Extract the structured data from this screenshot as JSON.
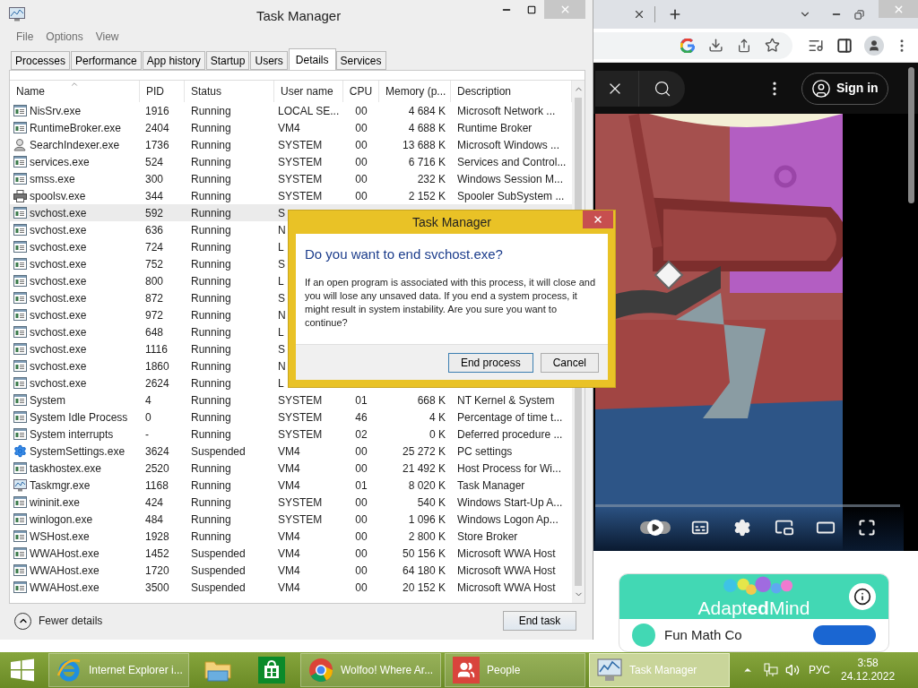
{
  "task_manager": {
    "title": "Task Manager",
    "menu": [
      "File",
      "Options",
      "View"
    ],
    "tabs": [
      {
        "label": "Processes",
        "selected": false
      },
      {
        "label": "Performance",
        "selected": false
      },
      {
        "label": "App history",
        "selected": false
      },
      {
        "label": "Startup",
        "selected": false
      },
      {
        "label": "Users",
        "selected": false
      },
      {
        "label": "Details",
        "selected": true
      },
      {
        "label": "Services",
        "selected": false
      }
    ],
    "columns": [
      {
        "label": "Name",
        "sorted": true
      },
      {
        "label": "PID",
        "sorted": false
      },
      {
        "label": "Status",
        "sorted": false
      },
      {
        "label": "User name",
        "sorted": false
      },
      {
        "label": "CPU",
        "sorted": false
      },
      {
        "label": "Memory (p...",
        "sorted": false
      },
      {
        "label": "Description",
        "sorted": false
      }
    ],
    "rows": [
      {
        "kind": "app",
        "name": "NisSrv.exe",
        "pid": "1916",
        "status": "Running",
        "user": "LOCAL SE...",
        "cpu": "00",
        "memory": "4 684 K",
        "description": "Microsoft Network ...",
        "selected": false
      },
      {
        "kind": "app",
        "name": "RuntimeBroker.exe",
        "pid": "2404",
        "status": "Running",
        "user": "VM4",
        "cpu": "00",
        "memory": "4 688 K",
        "description": "Runtime Broker",
        "selected": false
      },
      {
        "kind": "search",
        "name": "SearchIndexer.exe",
        "pid": "1736",
        "status": "Running",
        "user": "SYSTEM",
        "cpu": "00",
        "memory": "13 688 K",
        "description": "Microsoft Windows ...",
        "selected": false
      },
      {
        "kind": "app",
        "name": "services.exe",
        "pid": "524",
        "status": "Running",
        "user": "SYSTEM",
        "cpu": "00",
        "memory": "6 716 K",
        "description": "Services and Control...",
        "selected": false
      },
      {
        "kind": "app",
        "name": "smss.exe",
        "pid": "300",
        "status": "Running",
        "user": "SYSTEM",
        "cpu": "00",
        "memory": "232 K",
        "description": "Windows Session M...",
        "selected": false
      },
      {
        "kind": "printer",
        "name": "spoolsv.exe",
        "pid": "344",
        "status": "Running",
        "user": "SYSTEM",
        "cpu": "00",
        "memory": "2 152 K",
        "description": "Spooler SubSystem ...",
        "selected": false
      },
      {
        "kind": "app",
        "name": "svchost.exe",
        "pid": "592",
        "status": "Running",
        "user": "S",
        "selected": true
      },
      {
        "kind": "app",
        "name": "svchost.exe",
        "pid": "636",
        "status": "Running",
        "user": "N",
        "selected": false
      },
      {
        "kind": "app",
        "name": "svchost.exe",
        "pid": "724",
        "status": "Running",
        "user": "L",
        "selected": false
      },
      {
        "kind": "app",
        "name": "svchost.exe",
        "pid": "752",
        "status": "Running",
        "user": "S",
        "selected": false
      },
      {
        "kind": "app",
        "name": "svchost.exe",
        "pid": "800",
        "status": "Running",
        "user": "L",
        "selected": false
      },
      {
        "kind": "app",
        "name": "svchost.exe",
        "pid": "872",
        "status": "Running",
        "user": "S",
        "selected": false
      },
      {
        "kind": "app",
        "name": "svchost.exe",
        "pid": "972",
        "status": "Running",
        "user": "N",
        "selected": false
      },
      {
        "kind": "app",
        "name": "svchost.exe",
        "pid": "648",
        "status": "Running",
        "user": "L",
        "selected": false
      },
      {
        "kind": "app",
        "name": "svchost.exe",
        "pid": "1116",
        "status": "Running",
        "user": "S",
        "selected": false
      },
      {
        "kind": "app",
        "name": "svchost.exe",
        "pid": "1860",
        "status": "Running",
        "user": "N",
        "selected": false
      },
      {
        "kind": "app",
        "name": "svchost.exe",
        "pid": "2624",
        "status": "Running",
        "user": "L",
        "selected": false
      },
      {
        "kind": "app",
        "name": "System",
        "pid": "4",
        "status": "Running",
        "user": "SYSTEM",
        "cpu": "01",
        "memory": "668 K",
        "description": "NT Kernel & System",
        "selected": false
      },
      {
        "kind": "app",
        "name": "System Idle Process",
        "pid": "0",
        "status": "Running",
        "user": "SYSTEM",
        "cpu": "46",
        "memory": "4 K",
        "description": "Percentage of time t...",
        "selected": false
      },
      {
        "kind": "app",
        "name": "System interrupts",
        "pid": "-",
        "status": "Running",
        "user": "SYSTEM",
        "cpu": "02",
        "memory": "0 K",
        "description": "Deferred procedure ...",
        "selected": false
      },
      {
        "kind": "gear",
        "name": "SystemSettings.exe",
        "pid": "3624",
        "status": "Suspended",
        "user": "VM4",
        "cpu": "00",
        "memory": "25 272 K",
        "description": "PC settings",
        "selected": false
      },
      {
        "kind": "app",
        "name": "taskhostex.exe",
        "pid": "2520",
        "status": "Running",
        "user": "VM4",
        "cpu": "00",
        "memory": "21 492 K",
        "description": "Host Process for Wi...",
        "selected": false
      },
      {
        "kind": "monitor",
        "name": "Taskmgr.exe",
        "pid": "1168",
        "status": "Running",
        "user": "VM4",
        "cpu": "01",
        "memory": "8 020 K",
        "description": "Task Manager",
        "selected": false
      },
      {
        "kind": "app",
        "name": "wininit.exe",
        "pid": "424",
        "status": "Running",
        "user": "SYSTEM",
        "cpu": "00",
        "memory": "540 K",
        "description": "Windows Start-Up A...",
        "selected": false
      },
      {
        "kind": "app",
        "name": "winlogon.exe",
        "pid": "484",
        "status": "Running",
        "user": "SYSTEM",
        "cpu": "00",
        "memory": "1 096 K",
        "description": "Windows Logon Ap...",
        "selected": false
      },
      {
        "kind": "app",
        "name": "WSHost.exe",
        "pid": "1928",
        "status": "Running",
        "user": "VM4",
        "cpu": "00",
        "memory": "2 800 K",
        "description": "Store Broker",
        "selected": false
      },
      {
        "kind": "app",
        "name": "WWAHost.exe",
        "pid": "1452",
        "status": "Suspended",
        "user": "VM4",
        "cpu": "00",
        "memory": "50 156 K",
        "description": "Microsoft WWA Host",
        "selected": false
      },
      {
        "kind": "app",
        "name": "WWAHost.exe",
        "pid": "1720",
        "status": "Suspended",
        "user": "VM4",
        "cpu": "00",
        "memory": "64 180 K",
        "description": "Microsoft WWA Host",
        "selected": false
      },
      {
        "kind": "app",
        "name": "WWAHost.exe",
        "pid": "3500",
        "status": "Suspended",
        "user": "VM4",
        "cpu": "00",
        "memory": "20 152 K",
        "description": "Microsoft WWA Host",
        "selected": false
      }
    ],
    "fewer_details": "Fewer details",
    "end_task": "End task"
  },
  "dialog": {
    "title": "Task Manager",
    "heading": "Do you want to end svchost.exe?",
    "message": "If an open program is associated with this process, it will close and you will lose any unsaved data. If you end a system process, it might result in system instability. Are you sure you want to continue?",
    "buttons": [
      {
        "label": "End process",
        "focused": true
      },
      {
        "label": "Cancel",
        "focused": false
      }
    ]
  },
  "browser": {
    "sign_in": "Sign in",
    "video": {
      "autoplay": false
    },
    "ad": {
      "brand": "Adapt**ed**Mind",
      "title": "Fun Math Co"
    }
  },
  "taskbar": {
    "items": [
      {
        "kind": "ie",
        "label": "Internet Explorer i...",
        "active": false
      },
      {
        "kind": "explorer",
        "active": false
      },
      {
        "kind": "store",
        "active": false
      },
      {
        "kind": "chrome",
        "label": "Wolfoo! Where Ar...",
        "active": false
      },
      {
        "kind": "people",
        "label": "People",
        "active": false
      },
      {
        "kind": "taskmgr",
        "label": "Task Manager",
        "active": true
      }
    ],
    "language": "РУС",
    "time": "3:58",
    "date": "24.12.2022"
  }
}
